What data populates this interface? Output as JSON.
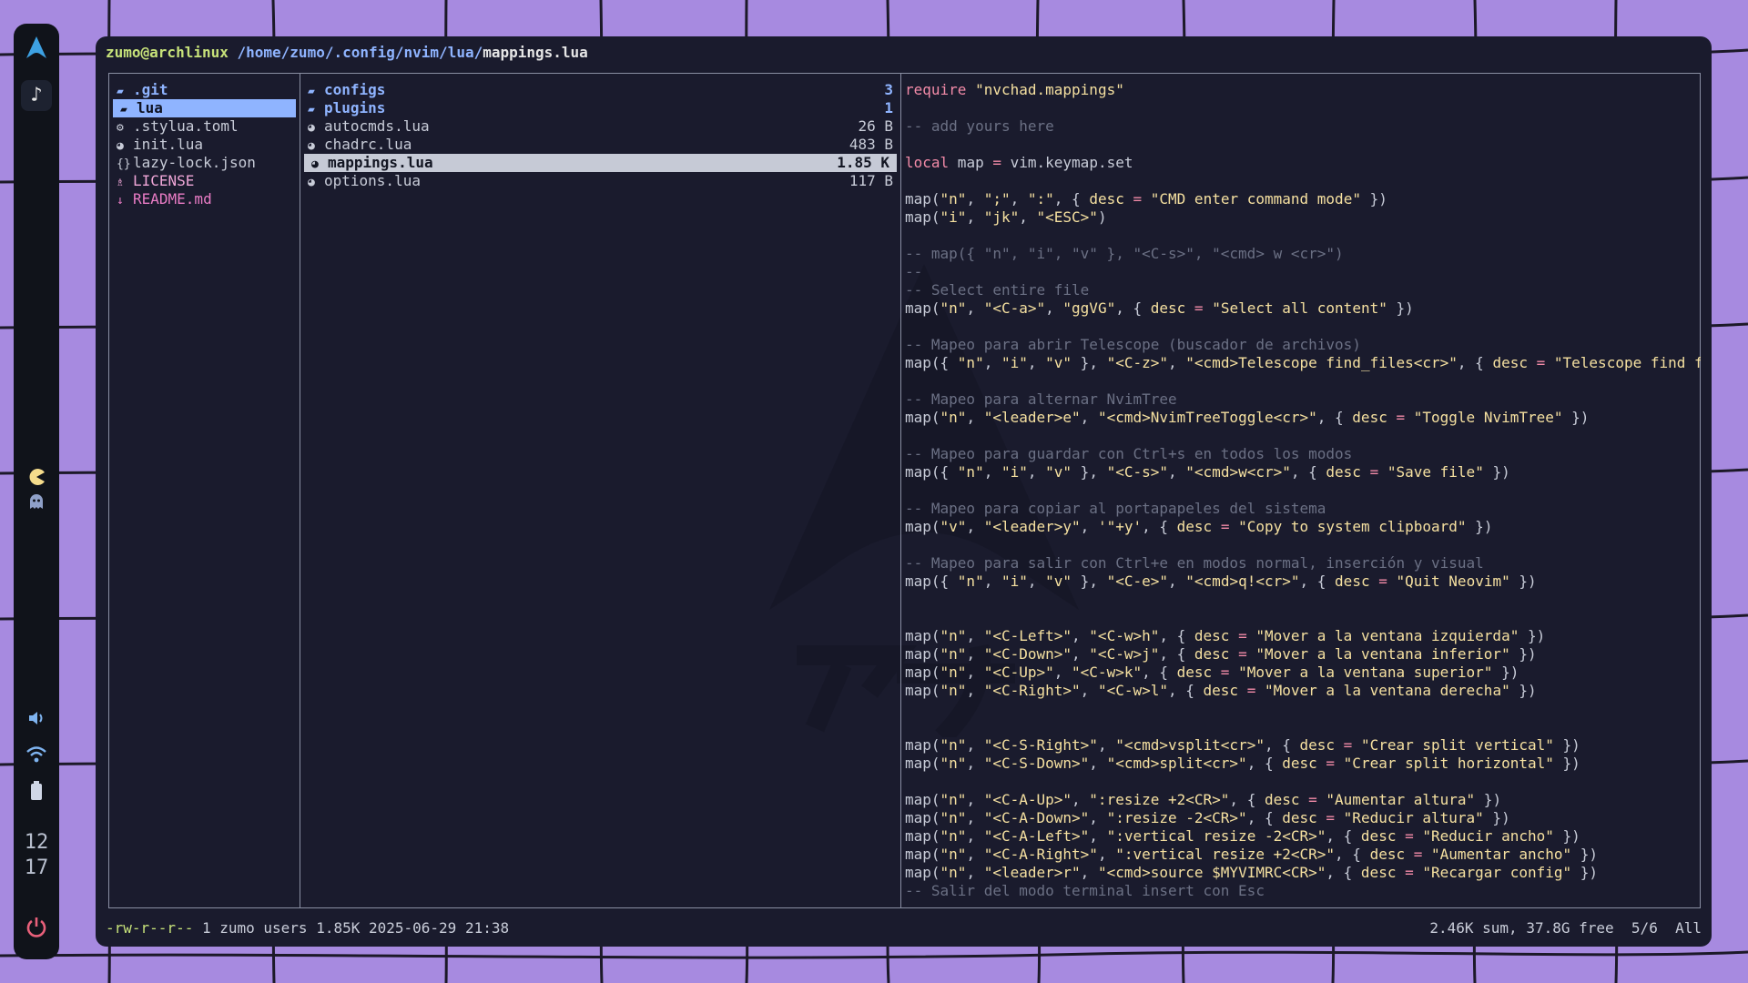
{
  "window": {
    "user_host": "zumo@archlinux",
    "path": "/home/zumo/.config/nvim/lua/",
    "file": "mappings.lua"
  },
  "parent_pane": {
    "items": [
      {
        "name": ".git",
        "icon": "folder-git-icon",
        "kind": "dir"
      },
      {
        "name": "lua",
        "icon": "folder-icon",
        "kind": "dir",
        "selected": true
      },
      {
        "name": ".stylua.toml",
        "icon": "gear-icon",
        "kind": "file"
      },
      {
        "name": "init.lua",
        "icon": "lua-icon",
        "kind": "file"
      },
      {
        "name": "lazy-lock.json",
        "icon": "json-icon",
        "kind": "file"
      },
      {
        "name": "LICENSE",
        "icon": "license-icon",
        "kind": "license"
      },
      {
        "name": "README.md",
        "icon": "markdown-icon",
        "kind": "readme"
      }
    ]
  },
  "current_pane": {
    "items": [
      {
        "name": "configs",
        "size": "3",
        "icon": "folder-icon",
        "kind": "dir"
      },
      {
        "name": "plugins",
        "size": "1",
        "icon": "folder-icon",
        "kind": "dir"
      },
      {
        "name": "autocmds.lua",
        "size": "26 B",
        "icon": "lua-icon",
        "kind": "file"
      },
      {
        "name": "chadrc.lua",
        "size": "483 B",
        "icon": "lua-icon",
        "kind": "file"
      },
      {
        "name": "mappings.lua",
        "size": "1.85 K",
        "icon": "lua-icon",
        "kind": "file",
        "selected": true
      },
      {
        "name": "options.lua",
        "size": "117 B",
        "icon": "lua-icon",
        "kind": "file"
      }
    ]
  },
  "preview": {
    "lines": [
      "require \"nvchad.mappings\"",
      "",
      "-- add yours here",
      "",
      "local map = vim.keymap.set",
      "",
      "map(\"n\", \";\", \":\", { desc = \"CMD enter command mode\" })",
      "map(\"i\", \"jk\", \"<ESC>\")",
      "",
      "-- map({ \"n\", \"i\", \"v\" }, \"<C-s>\", \"<cmd> w <cr>\")",
      "--",
      "-- Select entire file",
      "map(\"n\", \"<C-a>\", \"ggVG\", { desc = \"Select all content\" })",
      "",
      "-- Mapeo para abrir Telescope (buscador de archivos)",
      "map({ \"n\", \"i\", \"v\" }, \"<C-z>\", \"<cmd>Telescope find_files<cr>\", { desc = \"Telescope find files\"",
      "",
      "-- Mapeo para alternar NvimTree",
      "map(\"n\", \"<leader>e\", \"<cmd>NvimTreeToggle<cr>\", { desc = \"Toggle NvimTree\" })",
      "",
      "-- Mapeo para guardar con Ctrl+s en todos los modos",
      "map({ \"n\", \"i\", \"v\" }, \"<C-s>\", \"<cmd>w<cr>\", { desc = \"Save file\" })",
      "",
      "-- Mapeo para copiar al portapapeles del sistema",
      "map(\"v\", \"<leader>y\", '\"+y', { desc = \"Copy to system clipboard\" })",
      "",
      "-- Mapeo para salir con Ctrl+e en modos normal, inserción y visual",
      "map({ \"n\", \"i\", \"v\" }, \"<C-e>\", \"<cmd>q!<cr>\", { desc = \"Quit Neovim\" })",
      "",
      "",
      "map(\"n\", \"<C-Left>\", \"<C-w>h\", { desc = \"Mover a la ventana izquierda\" })",
      "map(\"n\", \"<C-Down>\", \"<C-w>j\", { desc = \"Mover a la ventana inferior\" })",
      "map(\"n\", \"<C-Up>\", \"<C-w>k\", { desc = \"Mover a la ventana superior\" })",
      "map(\"n\", \"<C-Right>\", \"<C-w>l\", { desc = \"Mover a la ventana derecha\" })",
      "",
      "",
      "map(\"n\", \"<C-S-Right>\", \"<cmd>vsplit<cr>\", { desc = \"Crear split vertical\" })",
      "map(\"n\", \"<C-S-Down>\", \"<cmd>split<cr>\", { desc = \"Crear split horizontal\" })",
      "",
      "map(\"n\", \"<C-A-Up>\", \":resize +2<CR>\", { desc = \"Aumentar altura\" })",
      "map(\"n\", \"<C-A-Down>\", \":resize -2<CR>\", { desc = \"Reducir altura\" })",
      "map(\"n\", \"<C-A-Left>\", \":vertical resize -2<CR>\", { desc = \"Reducir ancho\" })",
      "map(\"n\", \"<C-A-Right>\", \":vertical resize +2<CR>\", { desc = \"Aumentar ancho\" })",
      "map(\"n\", \"<leader>r\", \"<cmd>source $MYVIMRC<CR>\", { desc = \"Recargar config\" })",
      "-- Salir del modo terminal insert con Esc"
    ]
  },
  "status": {
    "permissions": "-rw-r--r--",
    "info": " 1 zumo users 1.85K 2025-06-29 21:38",
    "disk": "2.46K sum, 37.8G free",
    "position": "5/6",
    "scroll": "All"
  },
  "sidebar": {
    "clock_hour": "12",
    "clock_minute": "17",
    "icons": [
      "arch-logo-icon",
      "music-note-icon",
      "pacman-icon",
      "ghost-icon",
      "volume-icon",
      "wifi-icon",
      "battery-icon",
      "power-icon"
    ]
  },
  "colors": {
    "wallpaper": "#a78ae0",
    "terminal_bg": "#1a1b2d",
    "accent_blue": "#8fb4ff",
    "accent_green": "#c7e27a",
    "power_red": "#e8607a"
  }
}
